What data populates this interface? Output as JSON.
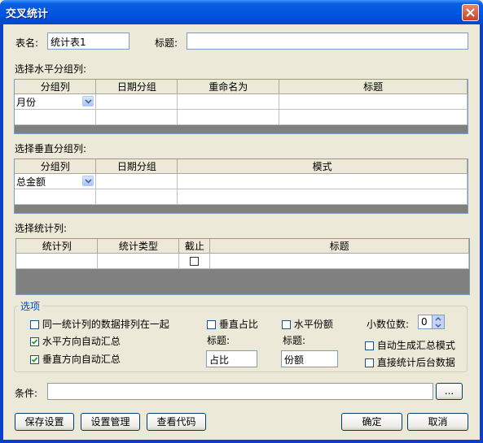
{
  "window": {
    "title": "交叉统计"
  },
  "form": {
    "table_name_label": "表名:",
    "table_name_value": "统计表1",
    "title_label": "标题:",
    "title_value": ""
  },
  "horizontal_group": {
    "label": "选择水平分组列:",
    "columns": [
      "分组列",
      "日期分组",
      "重命名为",
      "标题"
    ],
    "rows": [
      [
        "月份",
        "",
        "",
        ""
      ],
      [
        "",
        "",
        "",
        ""
      ]
    ]
  },
  "vertical_group": {
    "label": "选择垂直分组列:",
    "columns": [
      "分组列",
      "日期分组",
      "模式"
    ],
    "rows": [
      [
        "总金额",
        "",
        ""
      ],
      [
        "",
        "",
        ""
      ]
    ]
  },
  "stat_columns": {
    "label": "选择统计列:",
    "columns": [
      "统计列",
      "统计类型",
      "截止",
      "标题"
    ],
    "rows": [
      [
        "",
        "",
        "",
        ""
      ]
    ]
  },
  "options": {
    "legend": "选项",
    "same_stat_together": {
      "label": "同一统计列的数据排列在一起",
      "checked": false
    },
    "horizontal_auto_sum": {
      "label": "水平方向自动汇总",
      "checked": true
    },
    "vertical_auto_sum": {
      "label": "垂直方向自动汇总",
      "checked": true
    },
    "vertical_ratio": {
      "label": "垂直占比",
      "checked": false
    },
    "vertical_ratio_title_label": "标题:",
    "vertical_ratio_title_value": "占比",
    "horizontal_share": {
      "label": "水平份额",
      "checked": false
    },
    "horizontal_share_title_label": "标题:",
    "horizontal_share_title_value": "份额",
    "decimal_label": "小数位数:",
    "decimal_value": "0",
    "auto_summary_mode": {
      "label": "自动生成汇总模式",
      "checked": false
    },
    "direct_backend": {
      "label": "直接统计后台数据",
      "checked": false
    }
  },
  "condition": {
    "label": "条件:",
    "value": "",
    "browse_label": "..."
  },
  "buttons": {
    "save_settings": "保存设置",
    "manage_settings": "设置管理",
    "view_code": "查看代码",
    "ok": "确定",
    "cancel": "取消"
  },
  "colors": {
    "title_bar": "#0054e3",
    "close_button": "#c74422",
    "legend_text": "#0046d5",
    "dialog_bg": "#ece9d8"
  }
}
